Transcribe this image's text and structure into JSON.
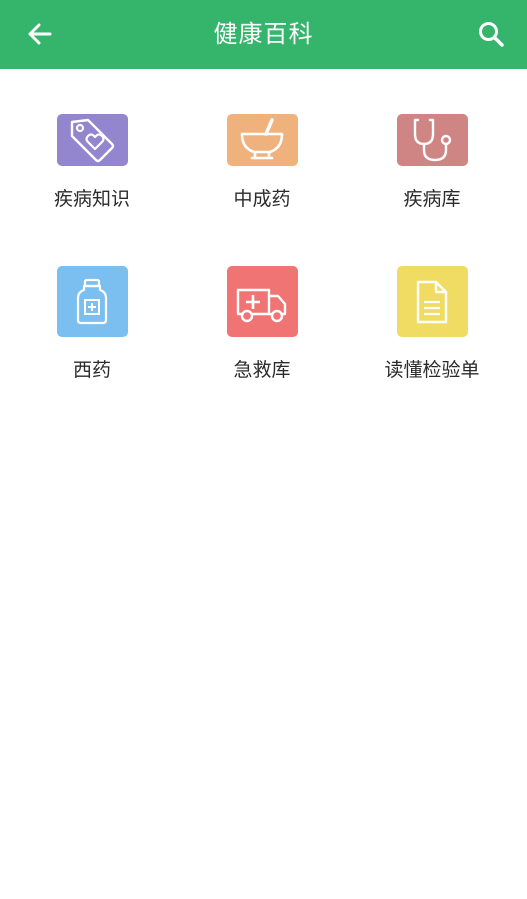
{
  "header": {
    "title": "健康百科",
    "back_icon": "arrow-left-icon",
    "search_icon": "search-icon",
    "background": "#35b46c"
  },
  "grid": {
    "items": [
      {
        "label": "疾病知识",
        "icon": "heart-tag-icon",
        "color": "#9386ce"
      },
      {
        "label": "中成药",
        "icon": "mortar-pestle-icon",
        "color": "#efb27c"
      },
      {
        "label": "疾病库",
        "icon": "stethoscope-icon",
        "color": "#cf8583"
      },
      {
        "label": "西药",
        "icon": "medicine-bottle-icon",
        "color": "#7bbff0"
      },
      {
        "label": "急救库",
        "icon": "ambulance-icon",
        "color": "#f07474"
      },
      {
        "label": "读懂检验单",
        "icon": "document-icon",
        "color": "#f0dc62"
      }
    ]
  }
}
